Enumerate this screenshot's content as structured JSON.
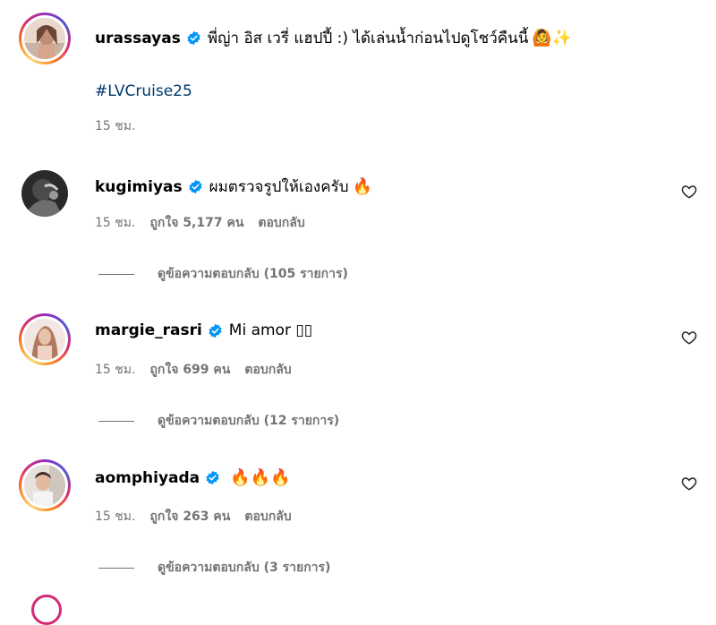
{
  "caption": {
    "username": "urassayas",
    "text": "พี่ญ่า อิส เวรี่ แฮปปี้ :) ได้เล่นน้ำก่อนไปดูโชว์คืนนี้",
    "emoji": "🙆✨",
    "hashtag": "#LVCruise25",
    "time": "15 ชม."
  },
  "comments": [
    {
      "username": "kugimiyas",
      "text": "ผมตรวจรูปให้เองครับ",
      "emoji": "🔥",
      "time": "15 ชม.",
      "likes": "ถูกใจ 5,177 คน",
      "reply_label": "ตอบกลับ",
      "view_replies": "ดูข้อความตอบกลับ (105 รายการ)"
    },
    {
      "username": "margie_rasri",
      "text": "Mi amor ▯▯",
      "emoji": "",
      "time": "15 ชม.",
      "likes": "ถูกใจ 699 คน",
      "reply_label": "ตอบกลับ",
      "view_replies": "ดูข้อความตอบกลับ (12 รายการ)"
    },
    {
      "username": "aomphiyada",
      "text": "",
      "emoji": "🔥🔥🔥",
      "time": "15 ชม.",
      "likes": "ถูกใจ 263 คน",
      "reply_label": "ตอบกลับ",
      "view_replies": "ดูข้อความตอบกลับ (3 รายการ)"
    }
  ],
  "icons": {
    "verified": "verified-badge-icon",
    "like": "heart-icon"
  },
  "colors": {
    "verified": "#0095f6",
    "hashtag": "#00376b",
    "secondary_text": "#737373"
  }
}
